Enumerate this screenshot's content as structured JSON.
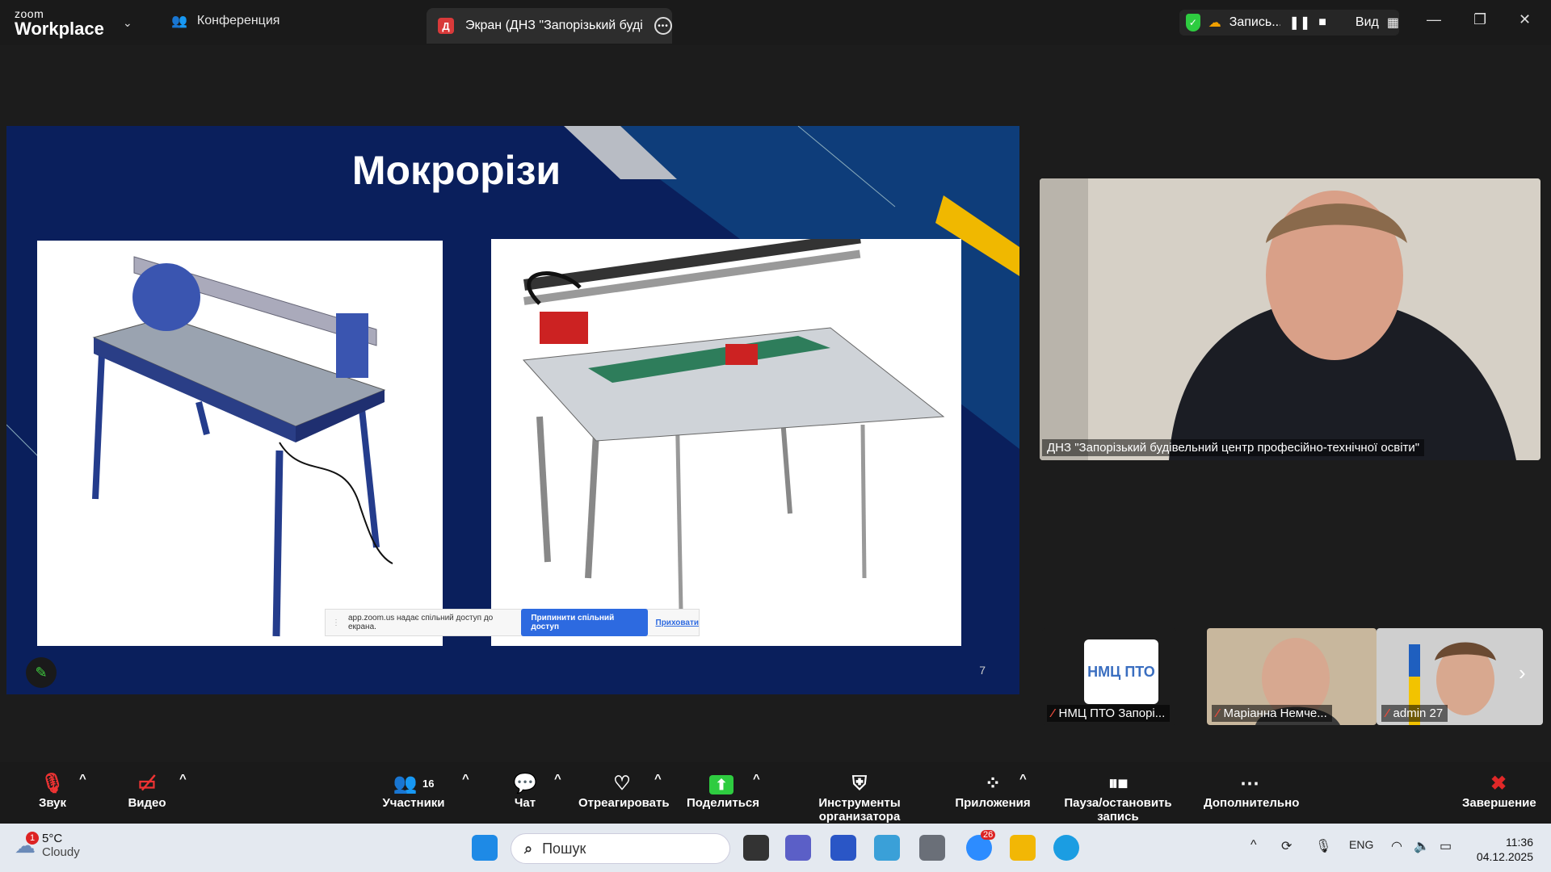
{
  "app": {
    "logo_top": "zoom",
    "logo_bottom": "Workplace"
  },
  "tabs": {
    "meeting": "Конференция",
    "screen_badge": "Д",
    "screen": "Экран (ДНЗ \"Запорізький будів"
  },
  "recording": {
    "label": "Запись...",
    "view": "Вид"
  },
  "slide": {
    "title": "Мокрорізи",
    "page_number": "7",
    "share_notice": {
      "text": "app.zoom.us надає спільний доступ до екрана.",
      "stop": "Припинити спільний доступ",
      "hide": "Приховати"
    }
  },
  "speaker": {
    "name": "ДНЗ \"Запорізький будівельний центр професійно-технічної освіти\""
  },
  "thumbnails": [
    {
      "name": "НМЦ ПТО Запорі...",
      "logo_text": "НМЦ ПТО"
    },
    {
      "name": "Маріанна Немче..."
    },
    {
      "name": "admin 27"
    }
  ],
  "toolbar": {
    "audio": "Звук",
    "video": "Видео",
    "participants": "Участники",
    "participants_count": "16",
    "chat": "Чат",
    "react": "Отреагировать",
    "share": "Поделиться",
    "host_tools": "Инструменты организатора",
    "apps": "Приложения",
    "pause_record": "Пауза/остановить запись",
    "more": "Дополнительно",
    "end": "Завершение"
  },
  "taskbar": {
    "temp": "5°C",
    "weather": "Cloudy",
    "weather_badge": "1",
    "search": "Пошук",
    "zoom_badge": "26",
    "lang": "ENG",
    "time": "11:36",
    "date": "04.12.2025"
  },
  "colors": {
    "slide_bg": "#0a1f5c",
    "accent_yellow": "#f0b800",
    "share_green": "#2ecc40",
    "end_red": "#e02828"
  }
}
